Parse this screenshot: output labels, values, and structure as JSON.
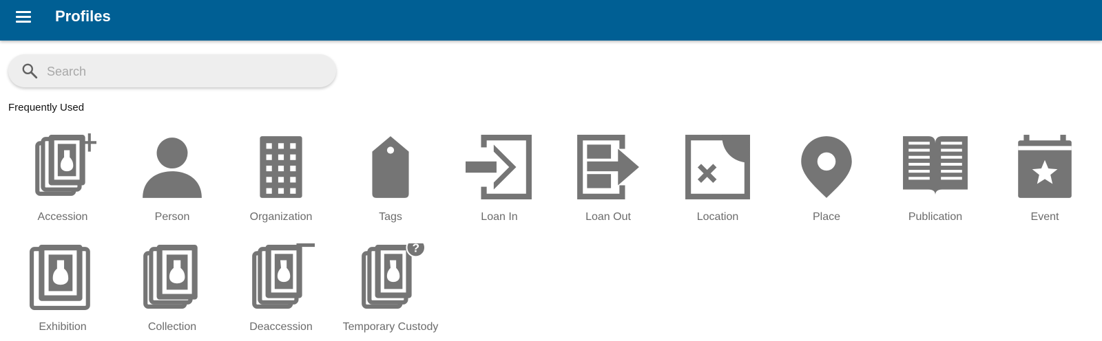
{
  "app": {
    "title": "Profiles",
    "menu_icon": "hamburger-menu-icon",
    "colors": {
      "appbar": "#005f94",
      "icon": "#757575",
      "label": "#6b6b6b"
    }
  },
  "search": {
    "placeholder": "Search",
    "value": "",
    "icon": "search-icon"
  },
  "frequently_used": {
    "title": "Frequently Used",
    "items": [
      {
        "label": "Accession",
        "icon": "accession-add-icon"
      },
      {
        "label": "Person",
        "icon": "person-icon"
      },
      {
        "label": "Organization",
        "icon": "building-icon"
      },
      {
        "label": "Tags",
        "icon": "tag-icon"
      },
      {
        "label": "Loan In",
        "icon": "loan-in-icon"
      },
      {
        "label": "Loan Out",
        "icon": "loan-out-icon"
      },
      {
        "label": "Location",
        "icon": "location-map-icon"
      },
      {
        "label": "Place",
        "icon": "place-pin-icon"
      },
      {
        "label": "Publication",
        "icon": "open-book-icon"
      },
      {
        "label": "Event",
        "icon": "calendar-star-icon"
      },
      {
        "label": "Exhibition",
        "icon": "exhibition-icon"
      },
      {
        "label": "Collection",
        "icon": "collection-icon"
      },
      {
        "label": "Deaccession",
        "icon": "deaccession-icon"
      },
      {
        "label": "Temporary Custody",
        "icon": "temporary-custody-icon"
      }
    ]
  }
}
